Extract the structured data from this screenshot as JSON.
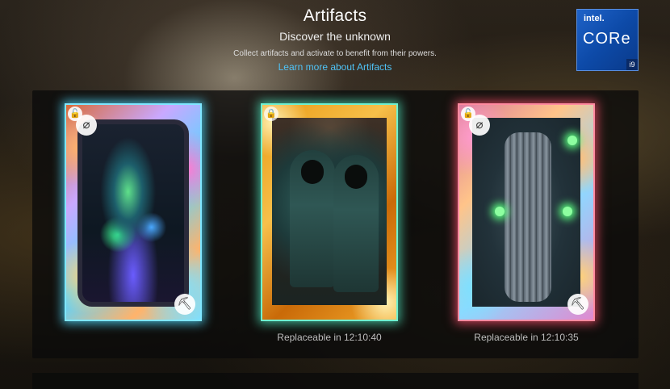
{
  "header": {
    "title": "Artifacts",
    "subtitle": "Discover the unknown",
    "description": "Collect artifacts and activate to benefit from their powers.",
    "learn_more": "Learn more about Artifacts"
  },
  "badge": {
    "brand": "intel.",
    "product": "CORe",
    "generation": "i9"
  },
  "cards": [
    {
      "glow_color": "#7fe6ff",
      "lock_icon": "unlock-icon",
      "corner_icon": "pickaxe-icon",
      "status": ""
    },
    {
      "glow_color": "#6ff0d0",
      "lock_icon": "lock-icon",
      "corner_icon": "",
      "status": "Replaceable in 12:10:40"
    },
    {
      "glow_color": "#ff8aa0",
      "lock_icon": "unlock-icon",
      "corner_icon": "pickaxe-icon",
      "status": "Replaceable in 12:10:35"
    }
  ]
}
